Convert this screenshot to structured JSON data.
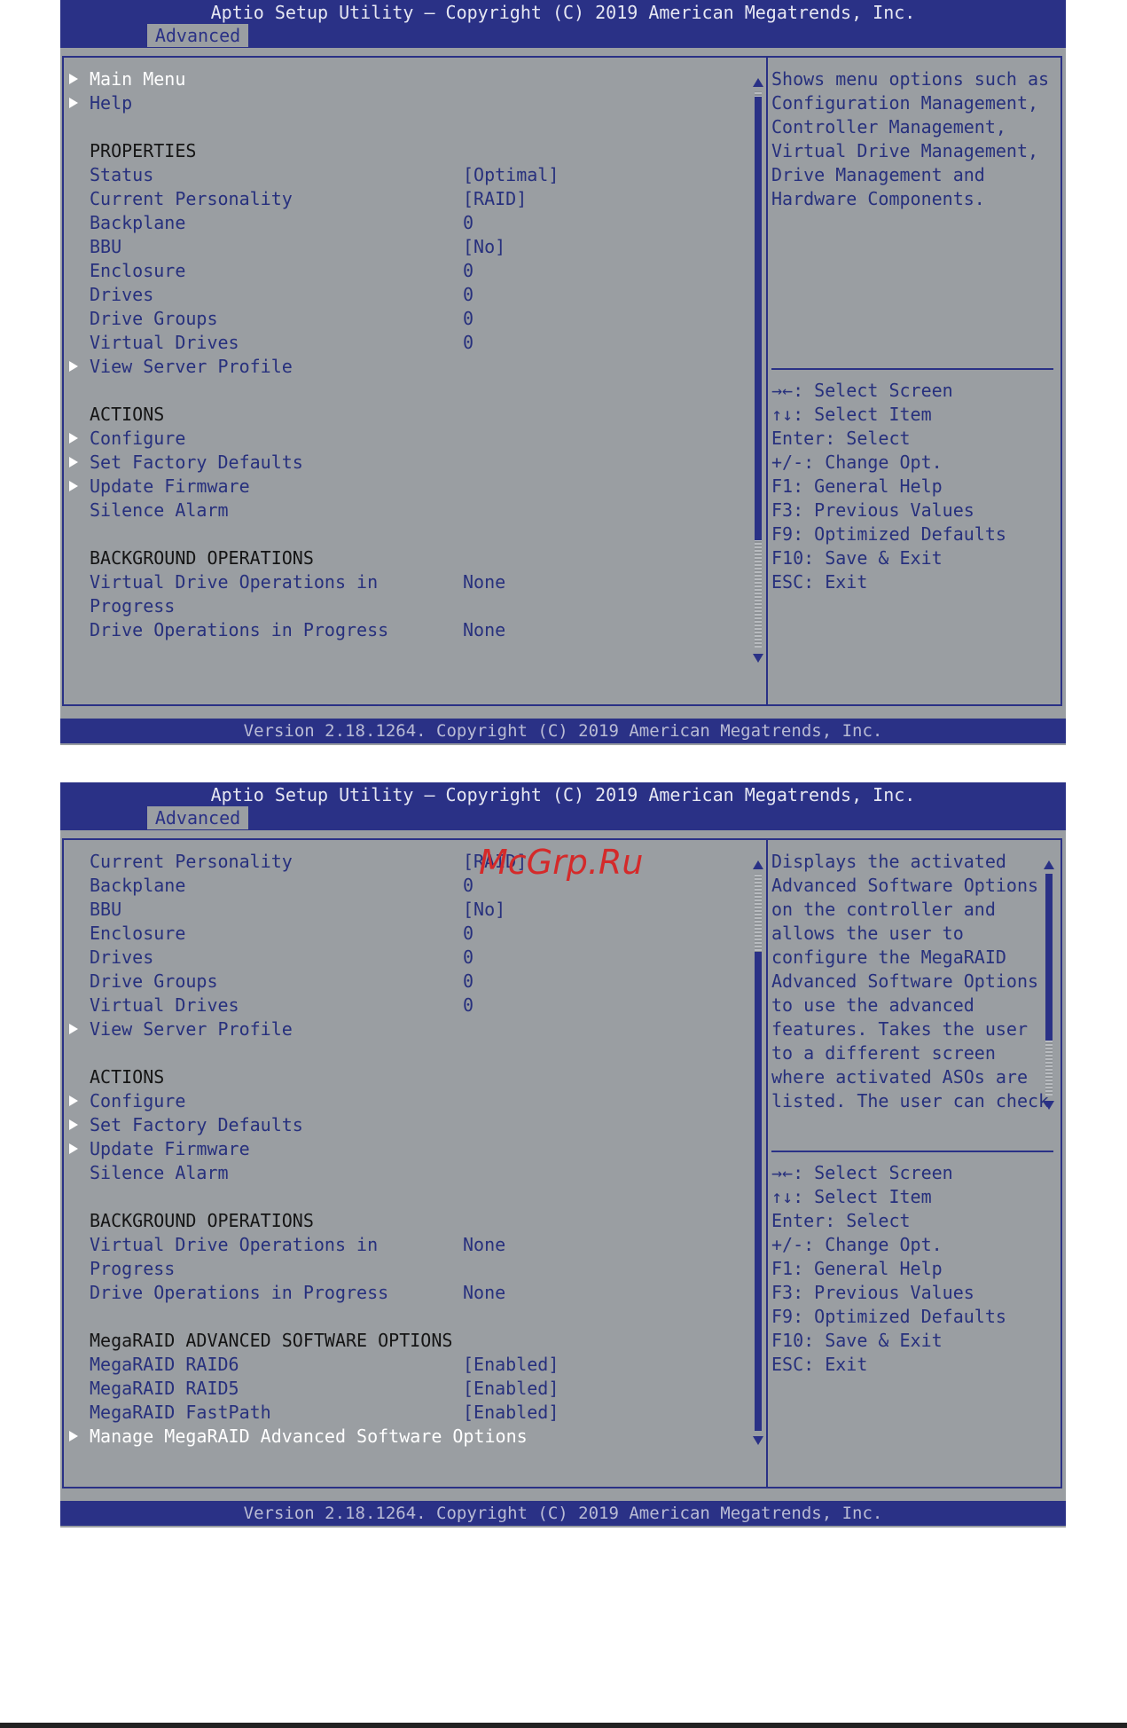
{
  "screen1": {
    "title": "Aptio Setup Utility – Copyright (C) 2019 American Megatrends, Inc.",
    "tab": "Advanced",
    "items": {
      "main_menu": "Main Menu",
      "help": "Help",
      "properties": "PROPERTIES",
      "status": "Status",
      "status_val": "[Optimal]",
      "personality": "Current Personality",
      "personality_val": "[RAID]",
      "backplane": "Backplane",
      "backplane_val": "0",
      "bbu": "BBU",
      "bbu_val": "[No]",
      "enclosure": "Enclosure",
      "enclosure_val": "0",
      "drives": "Drives",
      "drives_val": "0",
      "drive_groups": "Drive Groups",
      "drive_groups_val": "0",
      "virtual_drives": "Virtual Drives",
      "virtual_drives_val": "0",
      "view_server_profile": "View Server Profile",
      "actions": "ACTIONS",
      "configure": "Configure",
      "set_factory_defaults": "Set Factory Defaults",
      "update_firmware": "Update Firmware",
      "silence_alarm": "Silence Alarm",
      "background_ops": "BACKGROUND OPERATIONS",
      "vd_ops_1": "Virtual Drive Operations in",
      "vd_ops_2": "Progress",
      "vd_ops_val": "None",
      "drive_ops": "Drive Operations in Progress",
      "drive_ops_val": "None"
    },
    "help_text": [
      "Shows menu options such as",
      "Configuration Management,",
      "Controller Management,",
      "Virtual Drive Management,",
      "Drive Management and",
      "Hardware Components."
    ],
    "keys": [
      "→←: Select Screen",
      "↑↓: Select Item",
      "Enter: Select",
      "+/-: Change Opt.",
      "F1: General Help",
      "F3: Previous Values",
      "F9: Optimized Defaults",
      "F10: Save & Exit",
      "ESC: Exit"
    ],
    "footer": "Version 2.18.1264. Copyright (C) 2019 American Megatrends, Inc."
  },
  "screen2": {
    "title": "Aptio Setup Utility – Copyright (C) 2019 American Megatrends, Inc.",
    "tab": "Advanced",
    "items": {
      "personality": "Current Personality",
      "personality_val": "[RAID]",
      "backplane": "Backplane",
      "backplane_val": "0",
      "bbu": "BBU",
      "bbu_val": "[No]",
      "enclosure": "Enclosure",
      "enclosure_val": "0",
      "drives": "Drives",
      "drives_val": "0",
      "drive_groups": "Drive Groups",
      "drive_groups_val": "0",
      "virtual_drives": "Virtual Drives",
      "virtual_drives_val": "0",
      "view_server_profile": "View Server Profile",
      "actions": "ACTIONS",
      "configure": "Configure",
      "set_factory_defaults": "Set Factory Defaults",
      "update_firmware": "Update Firmware",
      "silence_alarm": "Silence Alarm",
      "background_ops": "BACKGROUND OPERATIONS",
      "vd_ops_1": "Virtual Drive Operations in",
      "vd_ops_2": "Progress",
      "vd_ops_val": "None",
      "drive_ops": "Drive Operations in Progress",
      "drive_ops_val": "None",
      "aso_header": "MegaRAID ADVANCED SOFTWARE OPTIONS",
      "raid6": "MegaRAID RAID6",
      "raid6_val": "[Enabled]",
      "raid5": "MegaRAID RAID5",
      "raid5_val": "[Enabled]",
      "fastpath": "MegaRAID FastPath",
      "fastpath_val": "[Enabled]",
      "manage_aso": "Manage MegaRAID Advanced Software Options"
    },
    "help_text": [
      "Displays the activated",
      "Advanced Software Options",
      "on the controller and",
      "allows the user to",
      "configure the MegaRAID",
      "Advanced Software Options",
      "to use the advanced",
      "features. Takes the user",
      "to a different screen",
      "where activated ASOs are",
      "listed. The user can check"
    ],
    "keys": [
      "→←: Select Screen",
      "↑↓: Select Item",
      "Enter: Select",
      "+/-: Change Opt.",
      "F1: General Help",
      "F3: Previous Values",
      "F9: Optimized Defaults",
      "F10: Save & Exit",
      "ESC: Exit"
    ],
    "footer": "Version 2.18.1264. Copyright (C) 2019 American Megatrends, Inc."
  },
  "watermark": "McGrp.Ru",
  "colors": {
    "panel": "#9a9ea2",
    "bar": "#2a3186",
    "label": "#27307d",
    "watermark": "#d42a2a"
  }
}
